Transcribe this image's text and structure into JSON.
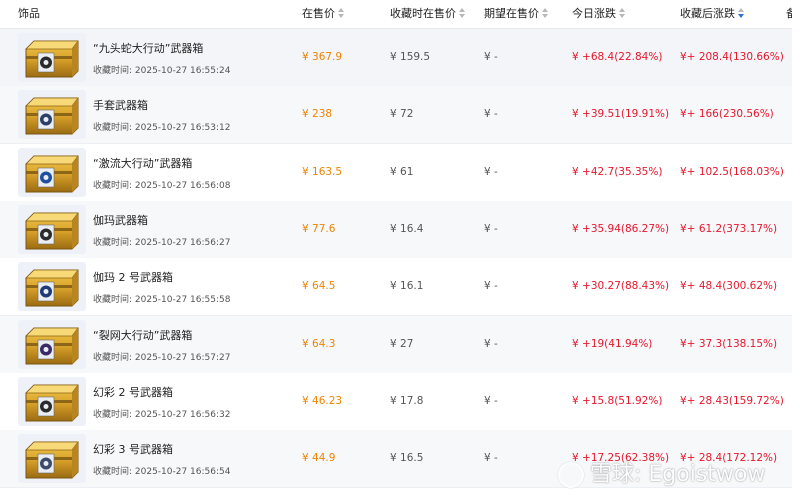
{
  "header": {
    "col_item": "饰品",
    "col_price": "在售价",
    "col_fav_price": "收藏时在售价",
    "col_expect": "期望在售价",
    "col_today": "今日涨跌",
    "col_since": "收藏后涨跌",
    "col_more": "备"
  },
  "colors": {
    "price": "#f08300",
    "up": "#e8162d",
    "muted": "#555555",
    "sort_active": "#2f6fd6"
  },
  "rows": [
    {
      "name": "“九头蛇大行动”武器箱",
      "time": "收藏时间: 2025-10-27 16:55:24",
      "price": "¥ 367.9",
      "fav_price": "¥ 159.5",
      "expect": "¥ -",
      "today": "¥ +68.4(22.84%)",
      "since": "¥+ 208.4(130.66%)",
      "icon": "hydra-emblem-icon"
    },
    {
      "name": "手套武器箱",
      "time": "收藏时间: 2025-10-27 16:53:12",
      "price": "¥ 238",
      "fav_price": "¥ 72",
      "expect": "¥ -",
      "today": "¥ +39.51(19.91%)",
      "since": "¥+ 166(230.56%)",
      "icon": "glove-emblem-icon"
    },
    {
      "name": "“激流大行动”武器箱",
      "time": "收藏时间: 2025-10-27 16:56:08",
      "price": "¥ 163.5",
      "fav_price": "¥ 61",
      "expect": "¥ -",
      "today": "¥ +42.7(35.35%)",
      "since": "¥+ 102.5(168.03%)",
      "icon": "riptide-emblem-icon"
    },
    {
      "name": "伽玛武器箱",
      "time": "收藏时间: 2025-10-27 16:56:27",
      "price": "¥ 77.6",
      "fav_price": "¥ 16.4",
      "expect": "¥ -",
      "today": "¥ +35.94(86.27%)",
      "since": "¥+ 61.2(373.17%)",
      "icon": "gamma-emblem-icon"
    },
    {
      "name": "伽玛 2 号武器箱",
      "time": "收藏时间: 2025-10-27 16:55:58",
      "price": "¥ 64.5",
      "fav_price": "¥ 16.1",
      "expect": "¥ -",
      "today": "¥ +30.27(88.43%)",
      "since": "¥+ 48.4(300.62%)",
      "icon": "gamma2-emblem-icon"
    },
    {
      "name": "“裂网大行动”武器箱",
      "time": "收藏时间: 2025-10-27 16:57:27",
      "price": "¥ 64.3",
      "fav_price": "¥ 27",
      "expect": "¥ -",
      "today": "¥ +19(41.94%)",
      "since": "¥+ 37.3(138.15%)",
      "icon": "shattered-web-emblem-icon"
    },
    {
      "name": "幻彩 2 号武器箱",
      "time": "收藏时间: 2025-10-27 16:56:32",
      "price": "¥ 46.23",
      "fav_price": "¥ 17.8",
      "expect": "¥ -",
      "today": "¥ +15.8(51.92%)",
      "since": "¥+ 28.43(159.72%)",
      "icon": "chroma2-emblem-icon"
    },
    {
      "name": "幻彩 3 号武器箱",
      "time": "收藏时间: 2025-10-27 16:56:54",
      "price": "¥ 44.9",
      "fav_price": "¥ 16.5",
      "expect": "¥ -",
      "today": "¥ +17.25(62.38%)",
      "since": "¥+ 28.4(172.12%)",
      "icon": "chroma3-emblem-icon"
    }
  ],
  "watermark": {
    "text": "雪球: Egoistwow",
    "icon": "snowball-logo-icon"
  }
}
